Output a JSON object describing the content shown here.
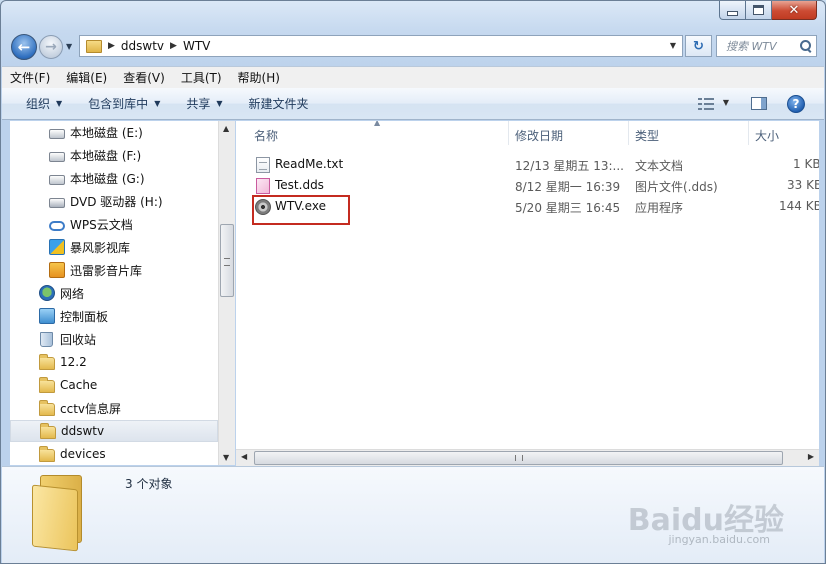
{
  "address": {
    "crumbs": [
      "ddswtv",
      "WTV"
    ]
  },
  "search": {
    "placeholder": "搜索 WTV"
  },
  "menu": [
    "文件(F)",
    "编辑(E)",
    "查看(V)",
    "工具(T)",
    "帮助(H)"
  ],
  "commands": {
    "organize": "组织",
    "include": "包含到库中",
    "share": "共享",
    "new_folder": "新建文件夹"
  },
  "nav": {
    "items": [
      {
        "label": "本地磁盘 (E:)",
        "icon": "drive-icon"
      },
      {
        "label": "本地磁盘 (F:)",
        "icon": "drive-icon"
      },
      {
        "label": "本地磁盘 (G:)",
        "icon": "drive-icon"
      },
      {
        "label": "DVD 驱动器 (H:)",
        "icon": "dvd-icon"
      },
      {
        "label": "WPS云文档",
        "icon": "cloud-icon"
      },
      {
        "label": "暴风影视库",
        "icon": "storm-video-icon"
      },
      {
        "label": "迅雷影音片库",
        "icon": "thunder-video-icon"
      },
      {
        "label": "网络",
        "icon": "network-icon"
      },
      {
        "label": "控制面板",
        "icon": "control-panel-icon"
      },
      {
        "label": "回收站",
        "icon": "recycle-bin-icon"
      },
      {
        "label": "12.2",
        "icon": "folder-icon"
      },
      {
        "label": "Cache",
        "icon": "folder-icon"
      },
      {
        "label": "cctv信息屏",
        "icon": "folder-icon"
      },
      {
        "label": "ddswtv",
        "icon": "folder-icon",
        "selected": true
      },
      {
        "label": "devices",
        "icon": "folder-icon"
      }
    ]
  },
  "columns": {
    "name": "名称",
    "date": "修改日期",
    "type": "类型",
    "size": "大小"
  },
  "files": [
    {
      "name": "ReadMe.txt",
      "date": "12/13 星期五 13:...",
      "type": "文本文档",
      "size": "1 KB",
      "icon": "text-file-icon"
    },
    {
      "name": "Test.dds",
      "date": "8/12 星期一 16:39",
      "type": "图片文件(.dds)",
      "size": "33 KB",
      "icon": "image-file-icon"
    },
    {
      "name": "WTV.exe",
      "date": "5/20 星期三 16:45",
      "type": "应用程序",
      "size": "144 KB",
      "icon": "exe-file-icon"
    }
  ],
  "details": {
    "count": "3 个对象"
  },
  "watermark": {
    "main": "Baidu经验",
    "sub": "jingyan.baidu.com"
  }
}
